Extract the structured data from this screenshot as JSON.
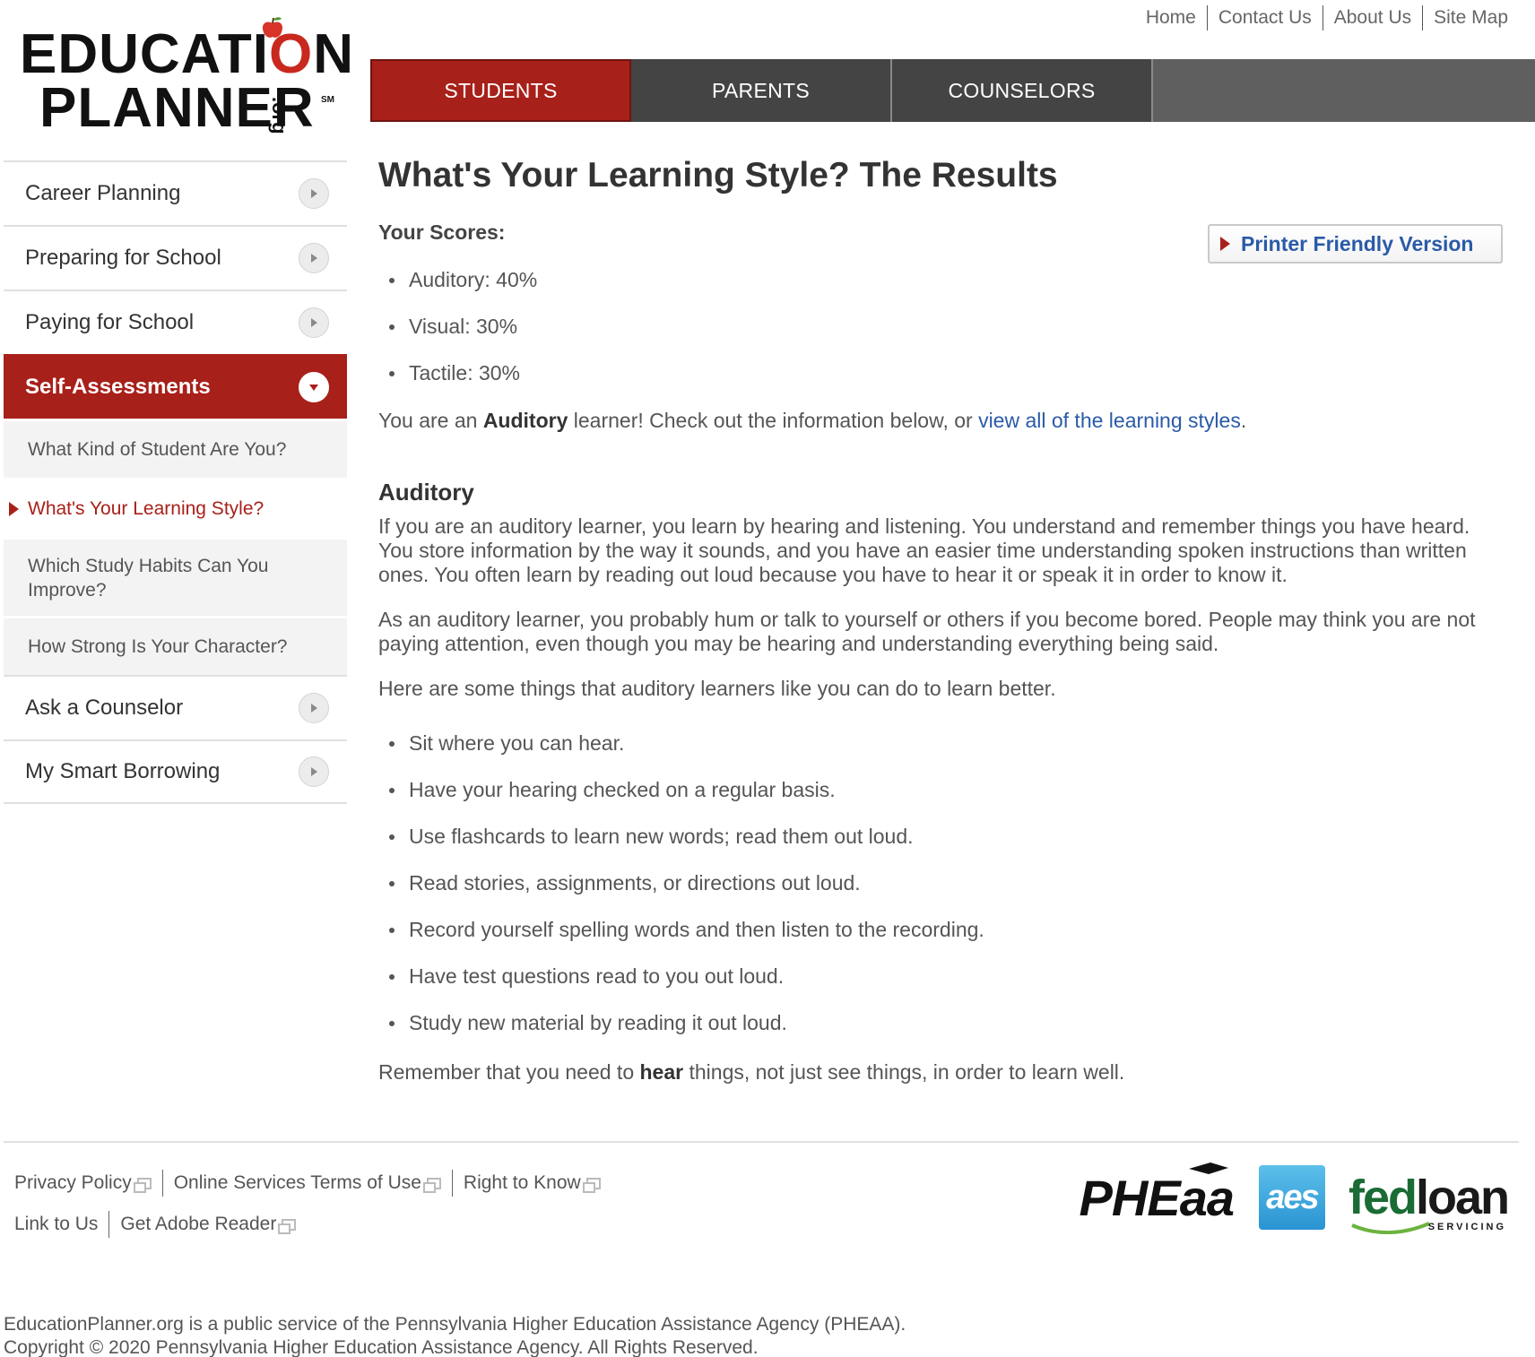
{
  "logo": {
    "line1_pre": "EDUCATI",
    "line1_o": "O",
    "line1_post": "N",
    "line2": "PLANNER",
    "org": ".org",
    "tm": "SM"
  },
  "utility_links": [
    "Home",
    "Contact Us",
    "About Us",
    "Site Map"
  ],
  "main_nav": {
    "students": "STUDENTS",
    "parents": "PARENTS",
    "counselors": "COUNSELORS"
  },
  "sidebar": {
    "career": "Career Planning",
    "preparing": "Preparing for School",
    "paying": "Paying for School",
    "self_assessments": "Self-Assessments",
    "sub": {
      "kind_of_student": "What Kind of Student Are You?",
      "learning_style": "What's Your Learning Style?",
      "study_habits": "Which Study Habits Can You Improve?",
      "character": "How Strong Is Your Character?"
    },
    "ask_counselor": "Ask a Counselor",
    "smart_borrowing": "My Smart Borrowing"
  },
  "content": {
    "title": "What's Your Learning Style? The Results",
    "scores_label": "Your Scores:",
    "printer_button": "Printer Friendly Version",
    "scores": [
      "Auditory: 40%",
      "Visual: 30%",
      "Tactile: 30%"
    ],
    "result": {
      "pre": "You are an ",
      "style": "Auditory",
      "mid": " learner! Check out the information below, or ",
      "link": "view all of the learning styles",
      "post": "."
    },
    "section_heading": "Auditory",
    "para1": "If you are an auditory learner, you learn by hearing and listening. You understand and remember things you have heard. You store information by the way it sounds, and you have an easier time understanding spoken instructions than written ones. You often learn by reading out loud because you have to hear it or speak it in order to know it.",
    "para2": "As an auditory learner, you probably hum or talk to yourself or others if you become bored. People may think you are not paying attention, even though you may be hearing and understanding everything being said.",
    "para3": "Here are some things that auditory learners like you can do to learn better.",
    "tips": [
      "Sit where you can hear.",
      "Have your hearing checked on a regular basis.",
      "Use flashcards to learn new words; read them out loud.",
      "Read stories, assignments, or directions out loud.",
      "Record yourself spelling words and then listen to the recording.",
      "Have test questions read to you out loud.",
      "Study new material by reading it out loud."
    ],
    "closing": {
      "pre": "Remember that you need to ",
      "bold": "hear",
      "post": " things, not just see things, in order to learn well."
    }
  },
  "footer": {
    "row1": [
      "Privacy Policy",
      "Online Services Terms of Use",
      "Right to Know"
    ],
    "row2": [
      "Link to Us",
      "Get Adobe Reader"
    ],
    "partners": {
      "pheaa": "PHEaa",
      "aes": "aes",
      "fedloan_fed": "fed",
      "fedloan_loan": "loan",
      "fedloan_servicing": "SERVICING"
    },
    "legal_line1": "EducationPlanner.org is a public service of the Pennsylvania Higher Education Assistance Agency (PHEAA).",
    "legal_line2": "Copyright © 2020 Pennsylvania Higher Education Assistance Agency. All Rights Reserved."
  },
  "colors": {
    "brand_red": "#a8201a",
    "nav_dark": "#444444",
    "link_blue": "#2a5aa8"
  }
}
